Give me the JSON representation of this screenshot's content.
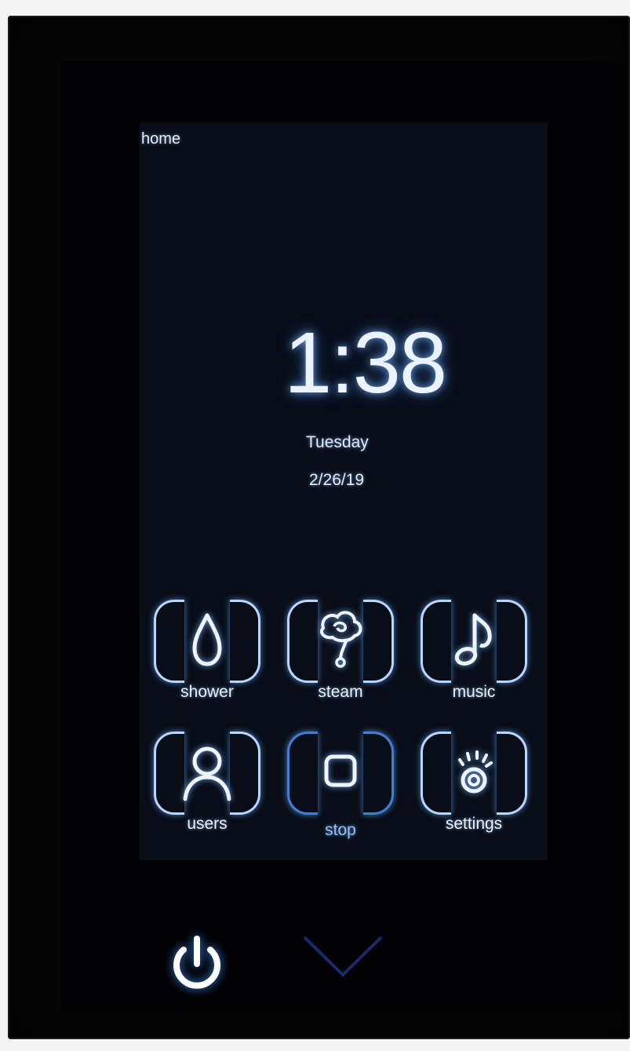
{
  "screen": {
    "page_label": "home",
    "time": "1:38",
    "weekday": "Tuesday",
    "date": "2/26/19"
  },
  "tiles": [
    {
      "label": "shower",
      "icon": "water-drop-icon"
    },
    {
      "label": "steam",
      "icon": "steam-cloud-icon"
    },
    {
      "label": "music",
      "icon": "music-note-icon"
    },
    {
      "label": "users",
      "icon": "user-icon"
    },
    {
      "label": "stop",
      "icon": "stop-square-icon"
    },
    {
      "label": "settings",
      "icon": "settings-sparkle-icon"
    }
  ],
  "hardware": {
    "power_icon": "power-icon",
    "down_icon": "chevron-down-icon"
  },
  "colors": {
    "glow": "#b9d6ff",
    "accent_blue": "#1f6fff",
    "screen_bg": "#080d18"
  }
}
